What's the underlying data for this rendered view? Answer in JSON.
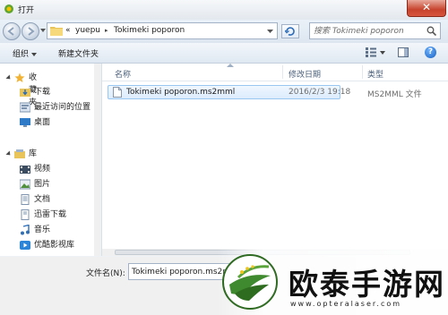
{
  "window": {
    "title": "打开"
  },
  "address": {
    "prefix": "«",
    "crumbs": [
      "yuepu",
      "Tokimeki poporon"
    ],
    "separator": "▸"
  },
  "search": {
    "placeholder": "搜索 Tokimeki poporon"
  },
  "toolbar": {
    "organize": "组织",
    "new_folder": "新建文件夹"
  },
  "nav": {
    "favorites_header": "收藏夹",
    "favorites": [
      {
        "label": "下载",
        "icon": "download-folder-icon"
      },
      {
        "label": "最近访问的位置",
        "icon": "recent-places-icon"
      },
      {
        "label": "桌面",
        "icon": "desktop-icon"
      }
    ],
    "libraries_header": "库",
    "libraries": [
      {
        "label": "视频",
        "icon": "video-library-icon"
      },
      {
        "label": "图片",
        "icon": "pictures-library-icon"
      },
      {
        "label": "文档",
        "icon": "documents-library-icon"
      },
      {
        "label": "迅雷下载",
        "icon": "thunder-download-icon"
      },
      {
        "label": "音乐",
        "icon": "music-library-icon"
      },
      {
        "label": "优酷影视库",
        "icon": "youku-library-icon"
      }
    ]
  },
  "columns": {
    "name": "名称",
    "modified": "修改日期",
    "type": "类型"
  },
  "files": [
    {
      "name": "Tokimeki poporon.ms2mml",
      "modified": "2016/2/3 19:18",
      "type": "MS2MML 文件"
    }
  ],
  "bottom": {
    "filename_label": "文件名(N):",
    "filename_value": "Tokimeki poporon.ms2mml"
  },
  "watermark": {
    "title": "欧泰手游网",
    "url": "www.opteralaser.com"
  },
  "colors": {
    "accent": "#1560c0",
    "selection": "#dcebfc",
    "logo_green": "#3f8a2e"
  }
}
